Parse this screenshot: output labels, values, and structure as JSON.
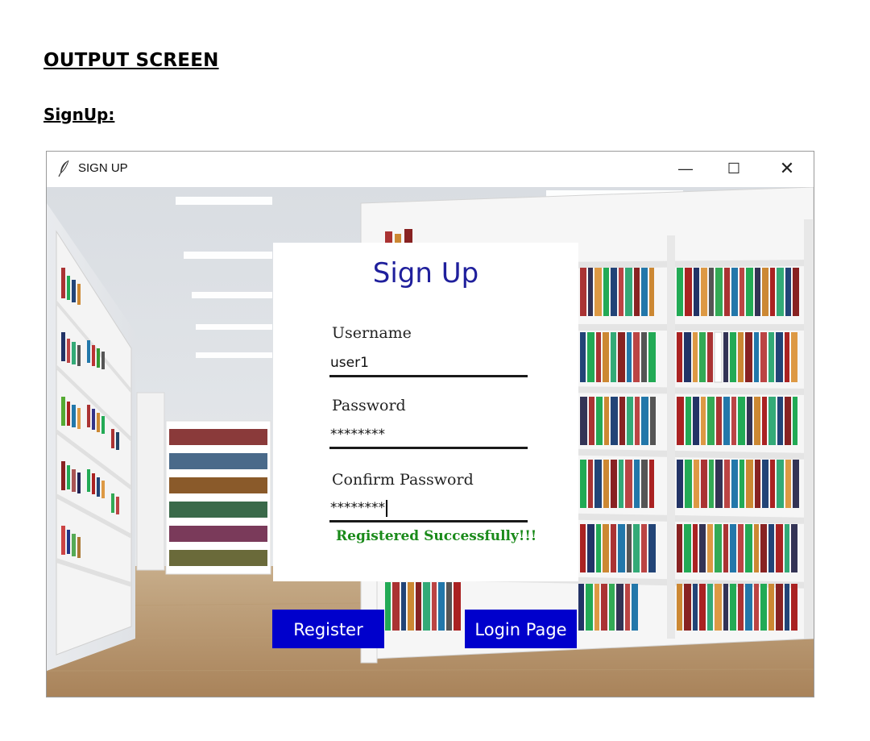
{
  "document": {
    "heading": "OUTPUT SCREEN",
    "subheading": "SignUp:"
  },
  "window": {
    "title": "SIGN UP",
    "app_icon": "feather-icon",
    "controls": {
      "minimize": "—",
      "maximize": "☐",
      "close": "✕"
    }
  },
  "form": {
    "title": "Sign Up",
    "fields": [
      {
        "label": "Username",
        "value": "user1"
      },
      {
        "label": "Password",
        "value": "********"
      },
      {
        "label": "Confirm Password",
        "value": "********"
      }
    ],
    "status_message": "Registered Successfully!!!",
    "status_color": "#1a8a1a"
  },
  "buttons": {
    "register": "Register",
    "login_page": "Login Page",
    "color": "#0000cc"
  },
  "background": "library-bookshelves-photo"
}
